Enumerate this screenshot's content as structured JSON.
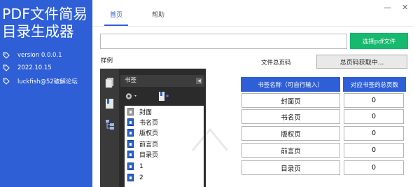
{
  "app": {
    "title": "PDF文件简易目录生成器",
    "version": "version  0.0.0.1",
    "date": "2022.10.15",
    "author": "luckfish@52破解论坛"
  },
  "nav": {
    "tabs": [
      {
        "label": "首页",
        "active": true
      },
      {
        "label": "帮助",
        "active": false
      }
    ]
  },
  "window_buttons": {
    "minimize": "—",
    "close": "✕"
  },
  "path": {
    "value": "",
    "select_label": "选择pdf文件"
  },
  "example": {
    "label": "样例",
    "panel_header": "书签",
    "items": [
      "封面",
      "书名页",
      "版权页",
      "前言页",
      "目录页",
      "1",
      "2"
    ]
  },
  "total": {
    "label": "文件总页码",
    "button_label": "总页码获取中..."
  },
  "table": {
    "headers": [
      "书签名称（可自行输入）",
      "对应书签的总页数"
    ],
    "rows": [
      {
        "name": "封面页",
        "page": "0"
      },
      {
        "name": "书名页",
        "page": "0"
      },
      {
        "name": "版权页",
        "page": "0"
      },
      {
        "name": "前言页",
        "page": "0"
      },
      {
        "name": "目录页",
        "page": "0"
      }
    ]
  },
  "colors": {
    "accent": "#2f5fd6",
    "select_button": "#16b96e"
  }
}
